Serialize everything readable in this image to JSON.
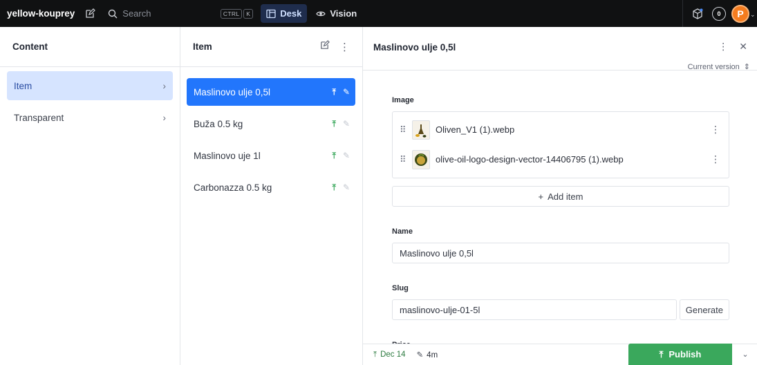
{
  "topbar": {
    "workspace": "yellow-kouprey",
    "search_placeholder": "Search",
    "kbd_ctrl": "CTRL",
    "kbd_k": "K",
    "tools": [
      {
        "label": "Desk",
        "active": true
      },
      {
        "label": "Vision",
        "active": false
      }
    ],
    "status_count": "0",
    "avatar_initial": "P"
  },
  "content_pane": {
    "title": "Content",
    "items": [
      {
        "label": "Item",
        "selected": true
      },
      {
        "label": "Transparent",
        "selected": false
      }
    ]
  },
  "items_pane": {
    "title": "Item",
    "documents": [
      {
        "label": "Maslinovo ulje 0,5l",
        "selected": true
      },
      {
        "label": "Buža 0.5 kg",
        "selected": false
      },
      {
        "label": "Maslinovo uje 1l",
        "selected": false
      },
      {
        "label": "Carbonazza 0.5 kg",
        "selected": false
      }
    ]
  },
  "document": {
    "title": "Maslinovo ulje 0,5l",
    "version_label": "Current version",
    "image_label": "Image",
    "images": [
      {
        "filename": "Oliven_V1 (1).webp"
      },
      {
        "filename": "olive-oil-logo-design-vector-14406795 (1).webp"
      }
    ],
    "add_item_label": "Add item",
    "name_label": "Name",
    "name_value": "Maslinovo ulje 0,5l",
    "slug_label": "Slug",
    "slug_value": "maslinovo-ulje-01-5l",
    "generate_label": "Generate",
    "price_label": "Price"
  },
  "footer": {
    "published_date": "Dec 14",
    "edited_ago": "4m",
    "publish_label": "Publish"
  },
  "colors": {
    "topbar_bg": "#101112",
    "selection_blue": "#2276fc",
    "nav_selected_bg": "#d6e4ff",
    "publish_green": "#3aa85c",
    "avatar_orange": "#f57c1f"
  }
}
